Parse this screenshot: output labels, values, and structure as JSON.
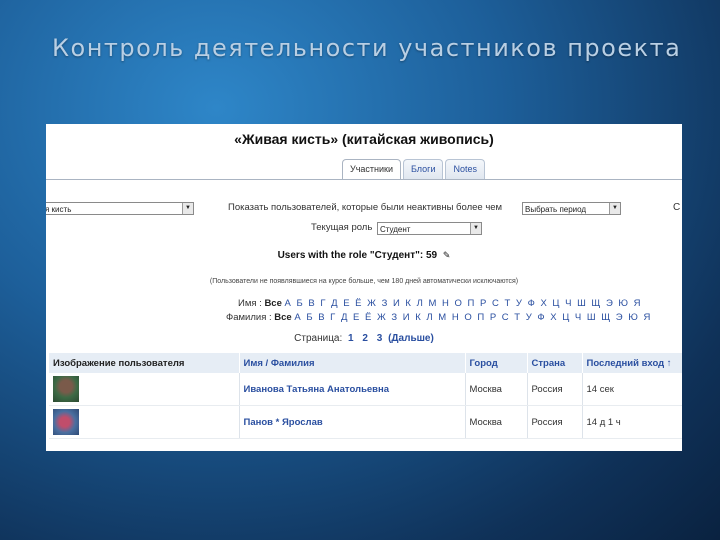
{
  "slide": {
    "title": "Контроль деятельности участников проекта"
  },
  "course": {
    "title": "«Живая кисть» (китайская живопись)"
  },
  "tabs": [
    {
      "label": "Участники",
      "active": true
    },
    {
      "label": "Блоги",
      "active": false
    },
    {
      "label": "Notes",
      "active": false
    }
  ],
  "filter": {
    "group_value": "я кисть",
    "show_label": "Показать пользователей, которые были неактивны более чем",
    "period_value": "Выбрать период",
    "role_label": "Текущая роль",
    "role_value": "Студент",
    "right_cut": "С"
  },
  "users_heading": "Users with the role \"Студент\": 59",
  "note": "(Пользователи не появлявшиеся на курсе больше, чем 180 дней автоматически исключаются)",
  "alphabet": {
    "first_label": "Имя :",
    "last_label": "Фамилия :",
    "all": "Все",
    "first_letters": "А Б В Г Д Е Ё Ж З И К Л М Н О П Р С Т У Ф Х Ц Ч Ш Щ Э Ю Я",
    "last_letters": "А Б В Г Д Е Ё Ж З И К Л М Н О П Р С Т У Ф Х Ц Ч Ш Щ Э Ю Я"
  },
  "pagination": {
    "label": "Страница:",
    "pages": [
      "1",
      "2",
      "3"
    ],
    "next": "(Дальше)"
  },
  "table": {
    "headers": [
      "Изображение пользователя",
      "Имя / Фамилия",
      "Город",
      "Страна",
      "Последний вход ↑"
    ],
    "rows": [
      {
        "name": "Иванова Татьяна Анатольевна",
        "city": "Москва",
        "country": "Россия",
        "last": "14 сек"
      },
      {
        "name": "Панов * Ярослав",
        "city": "Москва",
        "country": "Россия",
        "last": "14 д 1 ч"
      }
    ]
  },
  "icons": {
    "edit": "edit-pencil-icon",
    "avatar1": "user-photo-1",
    "avatar2": "user-photo-2"
  },
  "colors": {
    "link": "#2a4fa0",
    "header_bg": "#e6edf5",
    "slide_bg": "#1d5f9a"
  }
}
